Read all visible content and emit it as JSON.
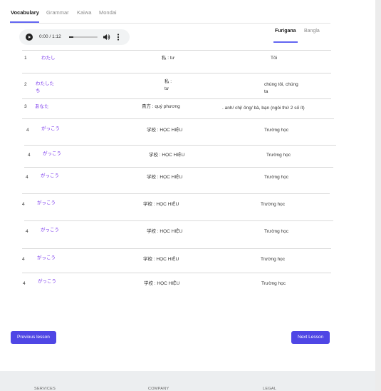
{
  "tabs": {
    "vocabulary": "Vocabulary",
    "grammar": "Grammar",
    "kaiwa": "Kaiwa",
    "mondai": "Mondai"
  },
  "player": {
    "time": "0:00 / 1:12",
    "progress": 0
  },
  "display_tabs": {
    "furigana": "Furigana",
    "bangla": "Bangla"
  },
  "rows": [
    {
      "num": "1",
      "kana": "わたし",
      "kanji": "私 : tư",
      "meaning": "Tôi"
    },
    {
      "num": "2",
      "kana_l1": "わたした",
      "kana_l2": "ち",
      "kanji_l1": "私 :",
      "kanji_l2": "tư",
      "meaning_l1": "chúng tôi, chúng",
      "meaning_l2": "ta"
    },
    {
      "num": "3",
      "kana": "あなた",
      "kanji": "貴方 : quý phương",
      "meaning": ". anh/ chị/ ông/ bà, bạn (ngôi thứ 2 số ít)"
    },
    {
      "num": "4",
      "kana": "がっこう",
      "kanji": "学校 : HỌC HIỆU",
      "meaning": "Trường học"
    },
    {
      "num": "4",
      "kana": "がっこう",
      "kanji": "学校 : HỌC HIỆU",
      "meaning": "Trường học"
    },
    {
      "num": "4",
      "kana": "がっこう",
      "kanji": "学校 : HỌC HIỆU",
      "meaning": "Trường học"
    },
    {
      "num": "4",
      "kana": "がっこう",
      "kanji": "学校 : HỌC HIỆU",
      "meaning": "Trường học"
    },
    {
      "num": "4",
      "kana": "がっこう",
      "kanji": "学校 : HỌC HIỆU",
      "meaning": "Trường học"
    },
    {
      "num": "4",
      "kana": "がっこう",
      "kanji": "学校 : HỌC HIỆU",
      "meaning": "Trường học"
    },
    {
      "num": "4",
      "kana": "がっこう",
      "kanji": "学校 : HỌC HIỆU",
      "meaning": "Trường học"
    }
  ],
  "nav": {
    "previous": "Previous lesson",
    "next": "Next Lesson"
  },
  "footer": {
    "services": "SERVICES",
    "company": "COMPANY",
    "legal": "LEGAL"
  },
  "colors": {
    "accent": "#4f46e5",
    "kana": "#7c3aed"
  },
  "icons": {
    "play": "play-icon",
    "volume": "volume-icon",
    "more": "more-vert-icon"
  }
}
